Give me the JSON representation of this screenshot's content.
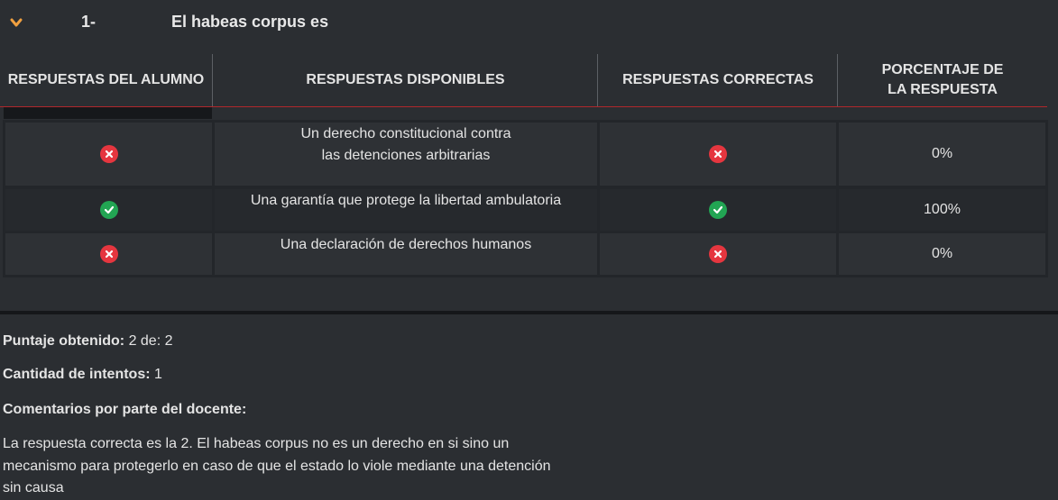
{
  "question": {
    "number": "1-",
    "text": "El habeas corpus es"
  },
  "table": {
    "headers": [
      "RESPUESTAS DEL ALUMNO",
      "RESPUESTAS DISPONIBLES",
      "RESPUESTAS CORRECTAS",
      "PORCENTAJE DE LA RESPUESTA"
    ],
    "rows": [
      {
        "student": "incorrect-icon",
        "answer": "Un derecho constitucional contra las detenciones arbitrarias",
        "correct": "incorrect-icon",
        "percent": "0%"
      },
      {
        "student": "correct-icon",
        "answer": "Una garantía que protege la libertad ambulatoria",
        "correct": "correct-icon",
        "percent": "100%"
      },
      {
        "student": "incorrect-icon",
        "answer": "Una declaración de derechos humanos",
        "correct": "incorrect-icon",
        "percent": "0%"
      }
    ]
  },
  "summary": {
    "score_label": "Puntaje obtenido:",
    "score_value": "2 de: 2",
    "attempts_label": "Cantidad de intentos:",
    "attempts_value": "1",
    "comments_label": "Comentarios por parte del docente:",
    "comment_text": "La respuesta correcta es la 2. El habeas corpus no es un derecho en si sino un mecanismo para protegerlo en caso de que el estado lo viole mediante una detención sin causa"
  },
  "colors": {
    "accent": "#f0a040",
    "incorrect": "#e5363f",
    "correct": "#22a553",
    "header_rule": "#b0282c"
  }
}
